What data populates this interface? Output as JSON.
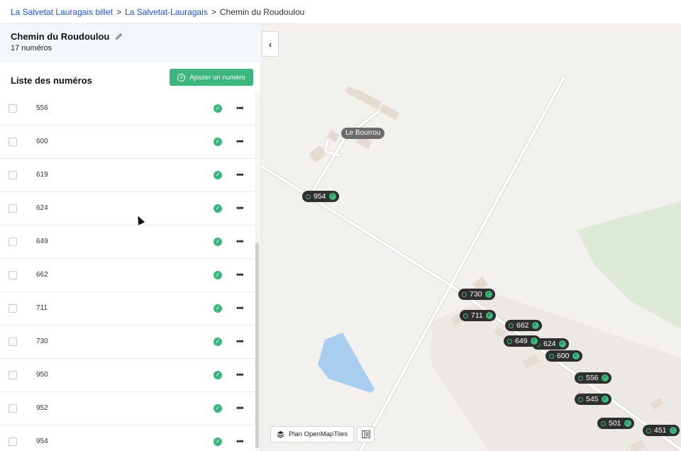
{
  "breadcrumb": {
    "items": [
      "La Salvetat Lauragais billet",
      "La Salvetat-Lauragais"
    ],
    "current": "Chemin du Roudoulou",
    "separator": ">"
  },
  "street": {
    "name": "Chemin du Roudoulou",
    "count_label": "17 numéros"
  },
  "list": {
    "title": "Liste des numéros",
    "add_button": "Ajouter un numéro",
    "rows": [
      "556",
      "600",
      "619",
      "624",
      "649",
      "662",
      "711",
      "730",
      "950",
      "952",
      "954"
    ]
  },
  "map": {
    "place_label": "Le Bourrou",
    "pins": [
      "954",
      "730",
      "711",
      "662",
      "649",
      "624",
      "600",
      "556",
      "545",
      "501",
      "451"
    ],
    "layer_button": "Plan OpenMapTiles",
    "colors": {
      "accent": "#3bb77e",
      "pin": "#2f2f2f",
      "map_bg": "#f3f1ee",
      "road": "#ffffff",
      "water": "#a9cdef",
      "park": "#dde8d5"
    }
  }
}
